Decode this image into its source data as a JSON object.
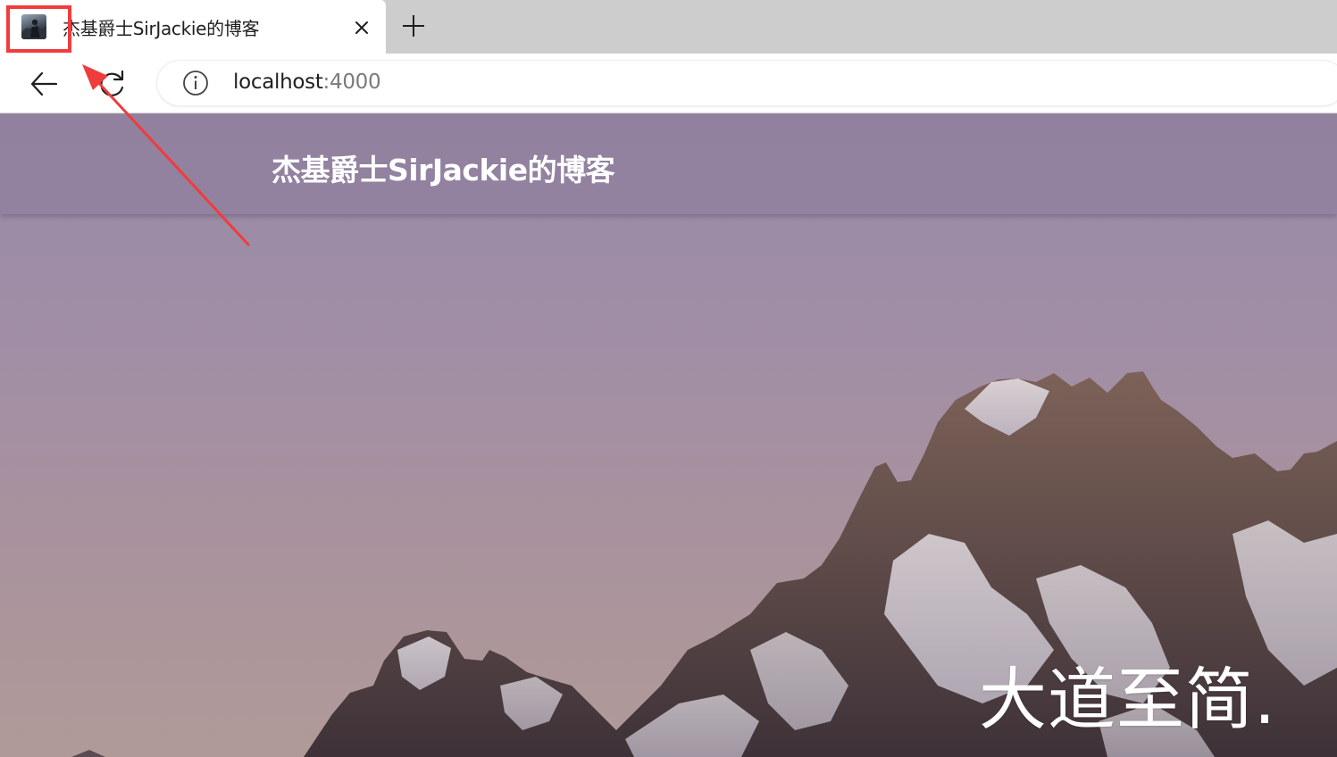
{
  "browser": {
    "tab": {
      "title": "杰基爵士SirJackie的博客",
      "favicon": "avatar-favicon",
      "close_icon": "close-icon"
    },
    "new_tab_icon": "plus-icon",
    "toolbar": {
      "back_icon": "back-arrow-icon",
      "reload_icon": "reload-icon",
      "info_icon": "info-icon",
      "url_host": "localhost",
      "url_port": ":4000"
    }
  },
  "page": {
    "site_title": "杰基爵士SirJackie的博客",
    "hero_text": "大道至简."
  },
  "annotation": {
    "highlight_color": "#f03c3c"
  },
  "colors": {
    "tabstrip": "#cdcdcd",
    "header_overlay": "#8c7a9b",
    "sky_top": "#978aa4",
    "sky_bottom": "#b09a98"
  }
}
